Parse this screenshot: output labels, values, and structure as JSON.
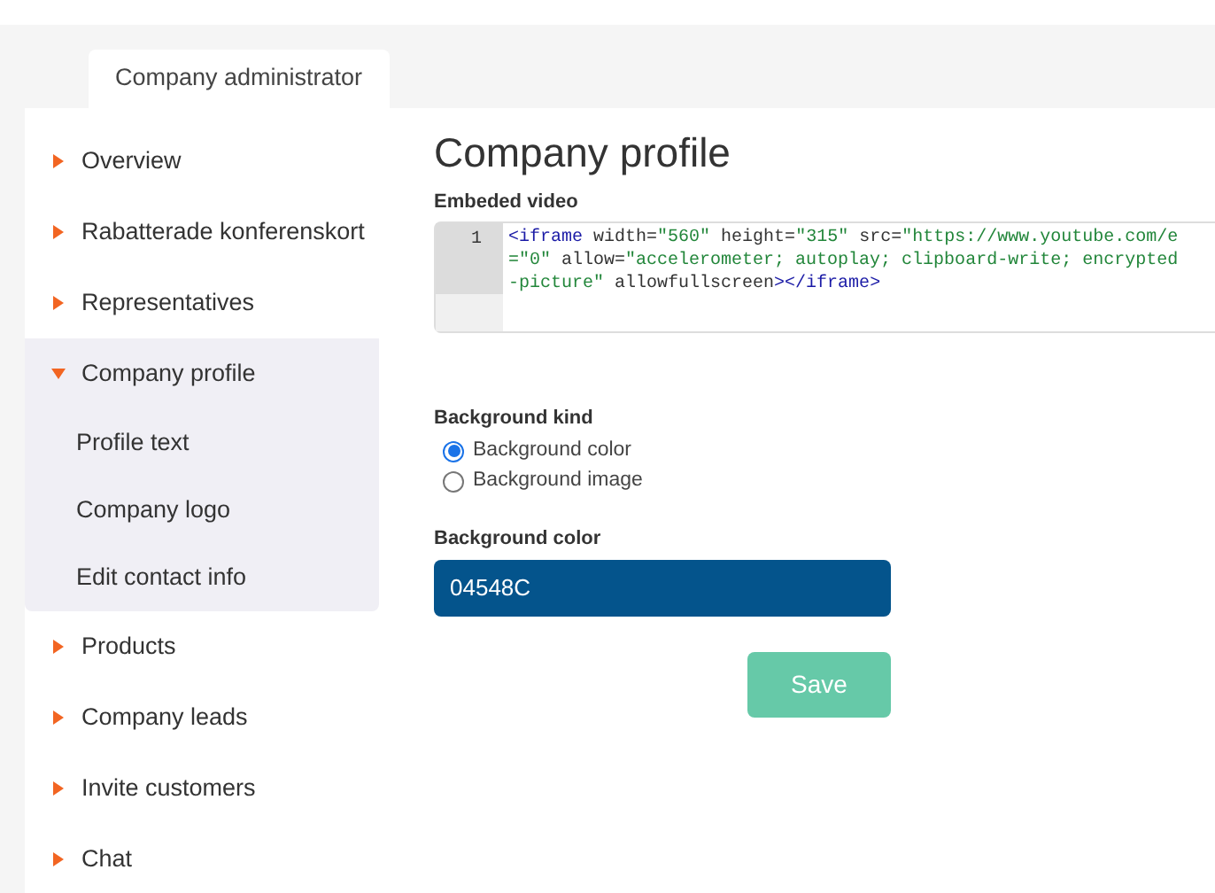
{
  "header_tab": {
    "label": "Company administrator",
    "selected": true
  },
  "sidebar": {
    "items": [
      {
        "label": "Overview",
        "expanded": false
      },
      {
        "label": "Rabatterade konferenskort",
        "expanded": false
      },
      {
        "label": "Representatives",
        "expanded": false
      },
      {
        "label": "Company profile",
        "expanded": true,
        "children": [
          {
            "label": "Profile text"
          },
          {
            "label": "Company logo"
          },
          {
            "label": "Edit contact info"
          }
        ]
      },
      {
        "label": "Products",
        "expanded": false
      },
      {
        "label": "Company leads",
        "expanded": false
      },
      {
        "label": "Invite customers",
        "expanded": false
      },
      {
        "label": "Chat",
        "expanded": false
      }
    ]
  },
  "page_title": "Company profile",
  "embed": {
    "label": "Embeded video",
    "line_number": "1",
    "lines": [
      [
        {
          "kind": "tag",
          "text": "<iframe"
        },
        {
          "kind": "attr",
          "text": " width="
        },
        {
          "kind": "value",
          "text": "\"560\""
        },
        {
          "kind": "attr",
          "text": " height="
        },
        {
          "kind": "value",
          "text": "\"315\""
        },
        {
          "kind": "attr",
          "text": " src="
        },
        {
          "kind": "value",
          "text": "\"https://www.youtube.com/e"
        }
      ],
      [
        {
          "kind": "value",
          "text": "=\"0\""
        },
        {
          "kind": "attr",
          "text": " allow="
        },
        {
          "kind": "value",
          "text": "\"accelerometer; autoplay; clipboard-write; encrypted"
        }
      ],
      [
        {
          "kind": "value",
          "text": "-picture\""
        },
        {
          "kind": "attr",
          "text": " allowfullscreen"
        },
        {
          "kind": "tag",
          "text": "></"
        },
        {
          "kind": "tag",
          "text": "iframe"
        },
        {
          "kind": "tag",
          "text": ">"
        }
      ]
    ]
  },
  "background_kind": {
    "label": "Background kind",
    "options": [
      {
        "label": "Background color",
        "selected": true
      },
      {
        "label": "Background image",
        "selected": false
      }
    ]
  },
  "background_color": {
    "label": "Background color",
    "value": "04548C"
  },
  "save_button": "Save"
}
